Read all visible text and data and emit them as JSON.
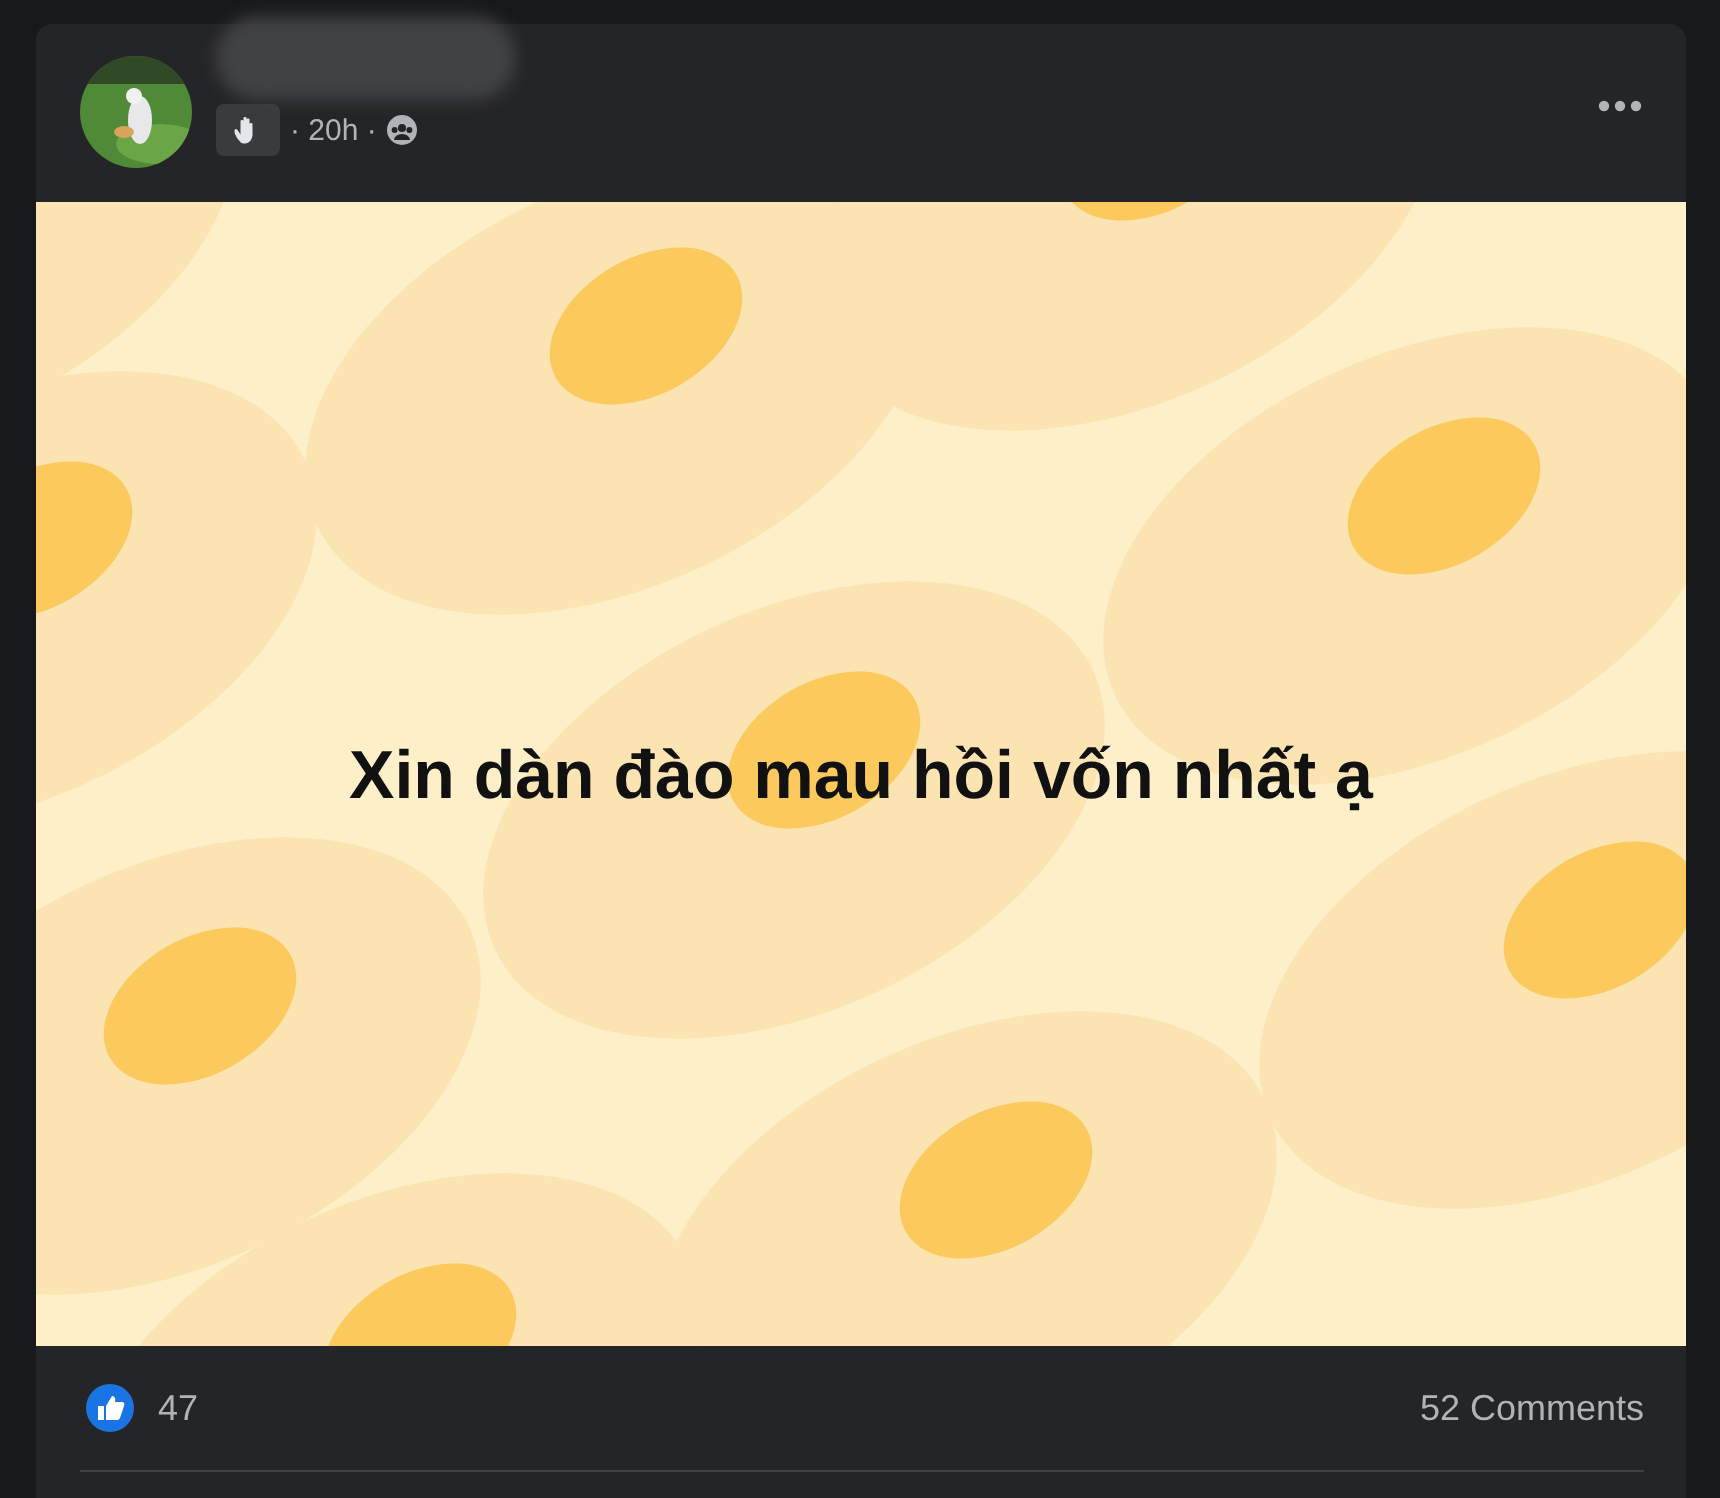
{
  "post": {
    "meta": "· 20h ·",
    "text": "Xin dàn đào mau hồi vốn nhất ạ"
  },
  "footer": {
    "reactions": "47",
    "comments": "52 Comments"
  }
}
